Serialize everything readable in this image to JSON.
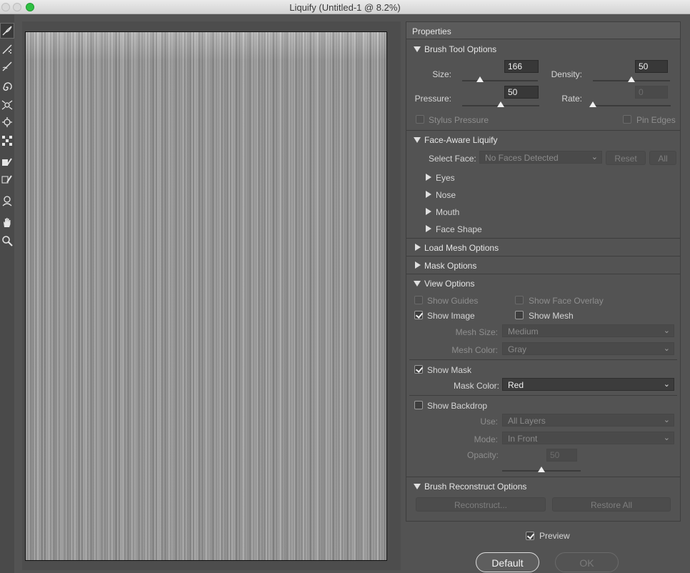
{
  "window": {
    "title": "Liquify (Untitled-1 @ 8.2%)"
  },
  "toolbar": {
    "tools": [
      {
        "name": "forward-warp-tool-icon"
      },
      {
        "name": "reconstruct-tool-icon"
      },
      {
        "name": "smooth-tool-icon"
      },
      {
        "name": "twirl-clockwise-tool-icon"
      },
      {
        "name": "pucker-tool-icon"
      },
      {
        "name": "bloat-tool-icon"
      },
      {
        "name": "push-left-tool-icon"
      },
      {
        "name": "freeze-mask-tool-icon"
      },
      {
        "name": "thaw-mask-tool-icon"
      },
      {
        "name": "face-tool-icon"
      },
      {
        "name": "hand-tool-icon"
      },
      {
        "name": "zoom-tool-icon"
      }
    ]
  },
  "panel": {
    "title": "Properties",
    "brush": {
      "header": "Brush Tool Options",
      "size_label": "Size:",
      "size_value": "166",
      "size_pct": 0.24,
      "density_label": "Density:",
      "density_value": "50",
      "density_pct": 0.5,
      "pressure_label": "Pressure:",
      "pressure_value": "50",
      "pressure_pct": 0.5,
      "rate_label": "Rate:",
      "rate_value": "0",
      "rate_pct": 0.0,
      "stylus_label": "Stylus Pressure",
      "pin_edges_label": "Pin Edges"
    },
    "face": {
      "header": "Face-Aware Liquify",
      "select_face_label": "Select Face:",
      "select_face_value": "No Faces Detected",
      "reset_label": "Reset",
      "all_label": "All",
      "items": [
        "Eyes",
        "Nose",
        "Mouth",
        "Face Shape"
      ]
    },
    "load_mesh_header": "Load Mesh Options",
    "mask_header": "Mask Options",
    "view": {
      "header": "View Options",
      "show_guides_label": "Show Guides",
      "show_face_overlay_label": "Show Face Overlay",
      "show_image_label": "Show Image",
      "show_mesh_label": "Show Mesh",
      "mesh_size_label": "Mesh Size:",
      "mesh_size_value": "Medium",
      "mesh_color_label": "Mesh Color:",
      "mesh_color_value": "Gray",
      "show_mask_label": "Show Mask",
      "mask_color_label": "Mask Color:",
      "mask_color_value": "Red",
      "show_backdrop_label": "Show Backdrop",
      "use_label": "Use:",
      "use_value": "All Layers",
      "mode_label": "Mode:",
      "mode_value": "In Front",
      "opacity_label": "Opacity:",
      "opacity_value": "50",
      "opacity_pct": 0.5
    },
    "reconstruct": {
      "header": "Brush Reconstruct Options",
      "reconstruct_label": "Reconstruct...",
      "restore_all_label": "Restore All"
    }
  },
  "footer": {
    "preview_label": "Preview",
    "default_label": "Default",
    "ok_label": "OK"
  }
}
